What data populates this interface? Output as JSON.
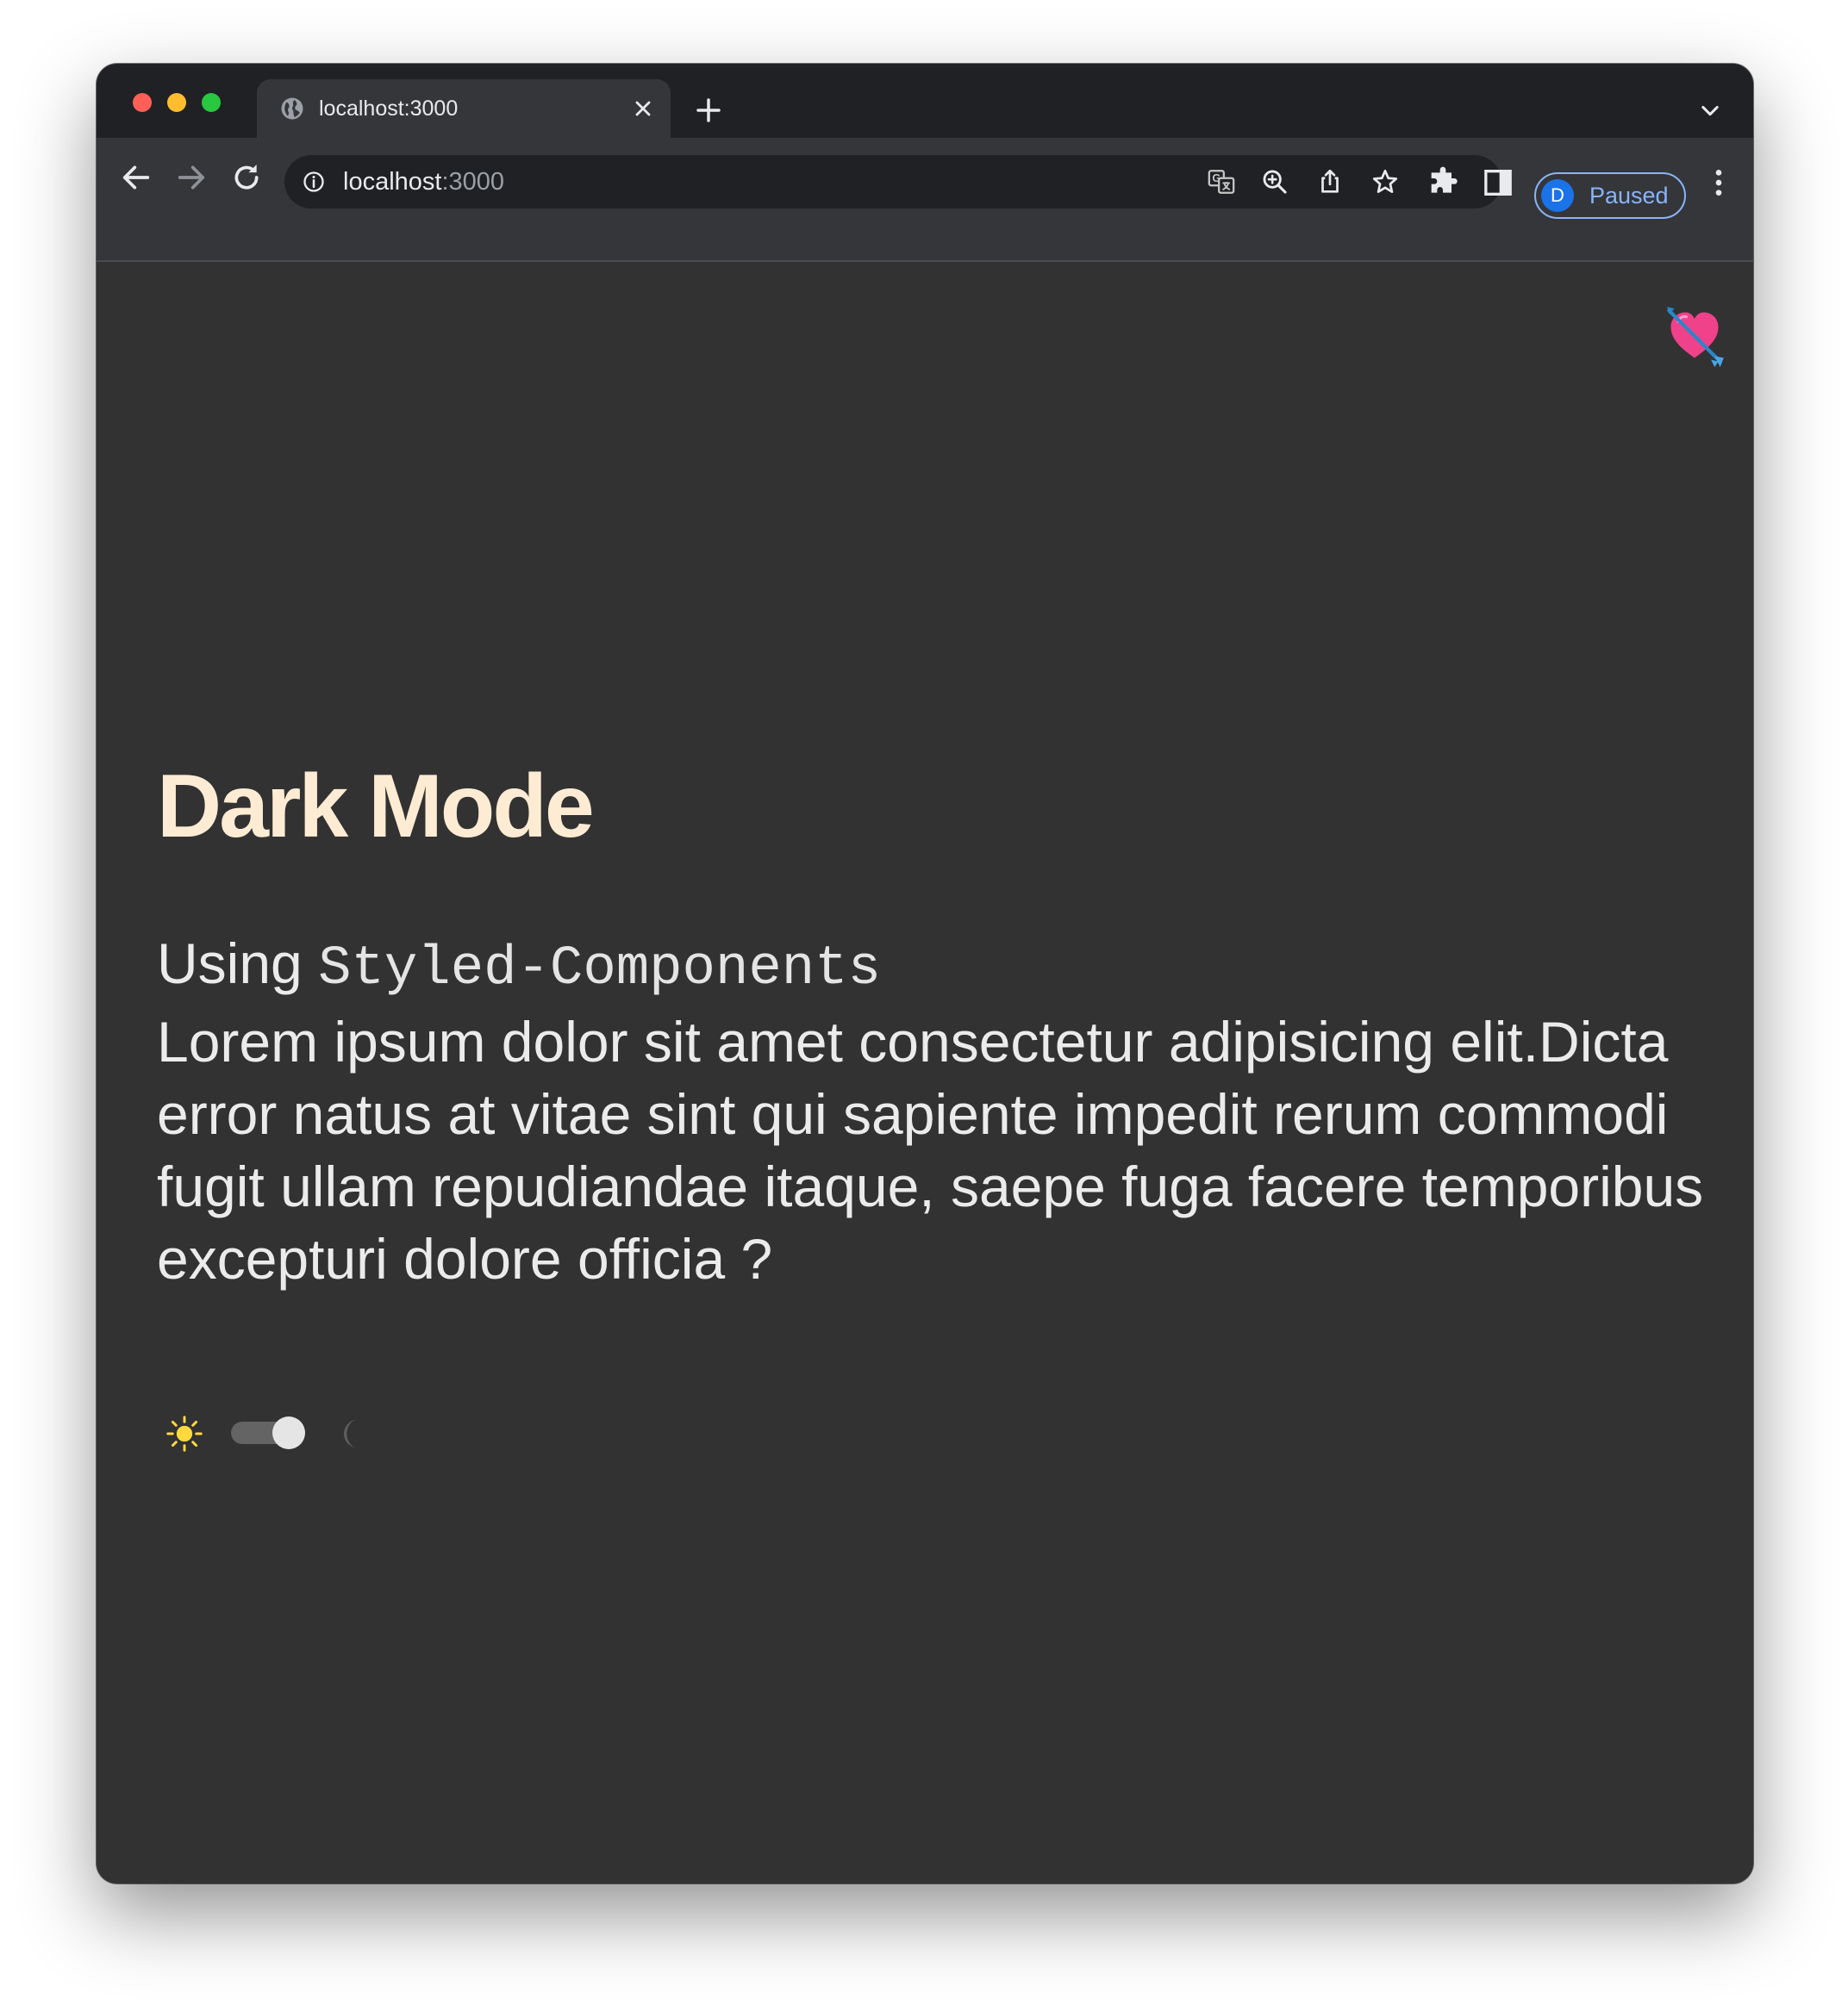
{
  "browser": {
    "tab": {
      "title": "localhost:3000",
      "favicon": "globe-icon"
    },
    "address_bar": {
      "host": "localhost",
      "port": ":3000",
      "site_info_icon": "info-icon"
    },
    "toolbar_icons": [
      "back-icon",
      "forward-icon",
      "reload-icon",
      "translate-icon",
      "zoom-icon",
      "share-icon",
      "star-icon",
      "extensions-icon",
      "side-panel-icon",
      "kebab-menu-icon"
    ],
    "profile": {
      "initial": "D",
      "status": "Paused"
    }
  },
  "page": {
    "corner_emoji": "💘",
    "heading": "Dark Mode",
    "subtitle_prefix": "Using ",
    "subtitle_code": "Styled-Components",
    "body_text": "Lorem ipsum dolor sit amet consectetur adipisicing elit.Dicta error natus at vitae sint qui sapiente impedit rerum commodi fugit ullam repudiandae itaque, saepe fuga facere temporibus excepturi dolore officia ?",
    "theme_toggle": {
      "left_icon": "sun-icon",
      "right_icon": "moon-icon",
      "state": "dark"
    }
  },
  "colors": {
    "page_background": "#323233",
    "heading": "#fdecd3",
    "body_text": "#ebebeb",
    "sun": "#ffd93d",
    "switch_track": "#646464",
    "switch_knob": "#e5e5e5",
    "profile_accent": "#8ab4f8"
  }
}
